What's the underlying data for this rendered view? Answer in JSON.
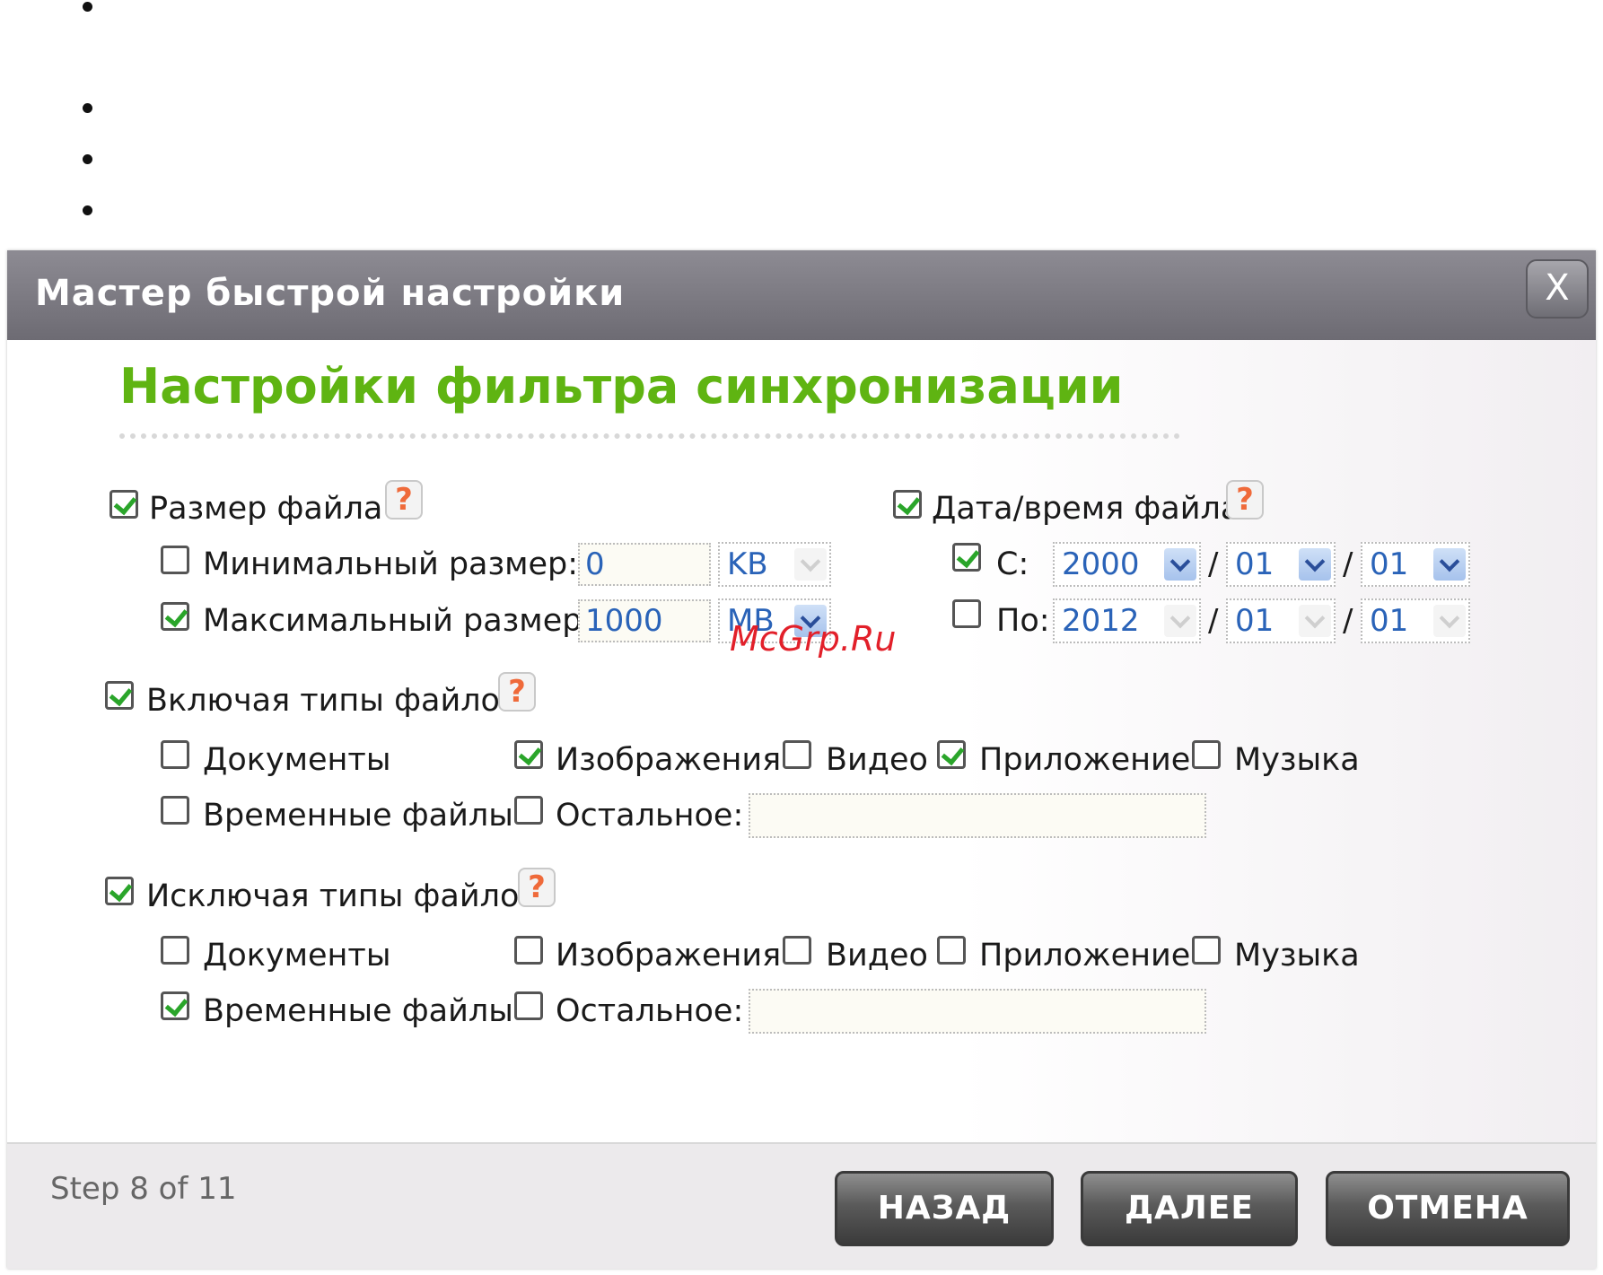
{
  "dialog": {
    "title": "Мастер быстрой настройки",
    "close_label": "X",
    "heading": "Настройки фильтра синхронизации"
  },
  "file_size": {
    "label": "Размер файла",
    "checked": true,
    "min_label": "Минимальный размер:",
    "min_checked": false,
    "min_value": "0",
    "min_unit": "KB",
    "max_label": "Максимальный размер:",
    "max_checked": true,
    "max_value": "1000",
    "max_unit": "MB"
  },
  "file_date": {
    "label": "Дата/время файла",
    "checked": true,
    "from_label": "С:",
    "from_checked": true,
    "from_year": "2000",
    "from_month": "01",
    "from_day": "01",
    "to_label": "По:",
    "to_checked": false,
    "to_year": "2012",
    "to_month": "01",
    "to_day": "01",
    "separator": "/"
  },
  "include": {
    "label": "Включая типы файлов",
    "checked": true,
    "documents": "Документы",
    "images": "Изображения",
    "video": "Видео",
    "application": "Приложение",
    "music": "Музыка",
    "temp": "Временные файлы",
    "other": "Остальное:",
    "other_value": ""
  },
  "exclude": {
    "label": "Исключая типы файлов",
    "checked": true,
    "documents": "Документы",
    "images": "Изображения",
    "video": "Видео",
    "application": "Приложение",
    "music": "Музыка",
    "temp": "Временные файлы",
    "other": "Остальное:",
    "other_value": ""
  },
  "help_glyph": "?",
  "watermark": "McGrp.Ru",
  "footer": {
    "step": "Step 8 of 11",
    "back": "НАЗАД",
    "next": "ДАЛЕЕ",
    "cancel": "ОТМЕНА"
  },
  "colors": {
    "heading": "#5fb412",
    "titlebar": "#7c7a82",
    "check": "#2aa52a",
    "help": "#ef6a3a",
    "value_text": "#2a63b8"
  }
}
